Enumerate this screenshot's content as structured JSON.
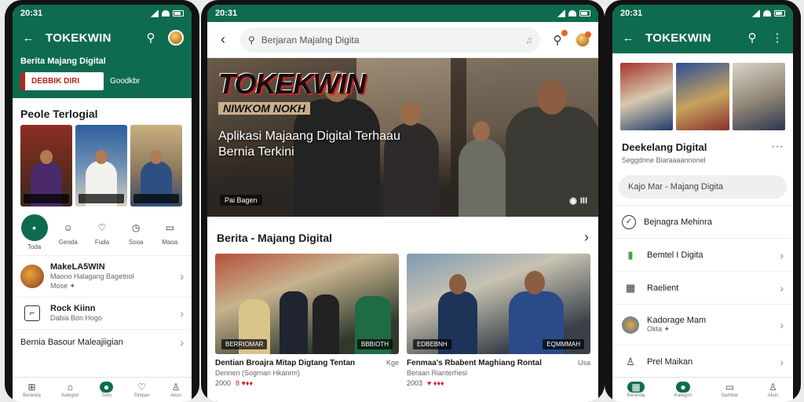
{
  "status_time": "20:31",
  "left": {
    "app_title": "TOKEKWIN",
    "banner_title": "Berita Majang Digital",
    "banner_card": "DEBBIK DIRI",
    "banner_side": "Goodkbr",
    "section_title": "Peole Terlogial",
    "tiles": [
      "",
      "",
      ""
    ],
    "quick": [
      {
        "label": "Toda",
        "icon": "•"
      },
      {
        "label": "Geoda",
        "icon": "☺"
      },
      {
        "label": "Fuda",
        "icon": "♡"
      },
      {
        "label": "Sooa",
        "icon": "◷"
      },
      {
        "label": "Maoa",
        "icon": "▭"
      }
    ],
    "list": [
      {
        "title": "MakeLA5WIN",
        "sub1": "Maono Halagang Bagetnol",
        "sub2": "Mose ✦"
      },
      {
        "title": "Rock Kiinn",
        "sub1": "Dabia Bon Hogo",
        "sub2": ""
      }
    ],
    "footer_item": "Bernia Basour Maleajiigian",
    "nav": [
      "Beranda",
      "Kategori",
      "Toko",
      "Simpan",
      "Akun"
    ]
  },
  "center": {
    "search_placeholder": "Berjaran Majalng Digita",
    "brand": "TOKEKWIN",
    "brand_sub": "NIWKOM NOKH",
    "hero_title": "Aplikasi Majaang Digital Terhaau Bernia Terkini",
    "hero_tag": "Pai Bagen",
    "hero_count": "III",
    "news_head": "Berita - Majang Digital",
    "news": [
      {
        "cap": "BERRIOMAR",
        "cnt": "BBBIOTH",
        "title": "Dentian Broajra Mitap Digtang Tentan",
        "time": "Kge",
        "sub": "Dennen (Sogrnan Hkanrm)",
        "meta1": "2000",
        "meta2": "8 ♥♦♦"
      },
      {
        "cap": "EDBEBNH",
        "cnt": "EQMMMAH",
        "title": "Fenmaa's Rbabent Maghiang Rontal",
        "time": "Usa",
        "sub": "Beraan Rianterhesi",
        "meta1": "2003",
        "meta2": "♥ ♦♦♦"
      }
    ]
  },
  "right": {
    "app_title": "TOKEKWIN",
    "title": "Deekelang Digital",
    "subtitle": "Seggdnne Biaraaaannonel",
    "search": "Kajo Mar - Majang Digita",
    "menu": [
      {
        "label": "Bejnagra Mehinra",
        "icon": "✓"
      },
      {
        "label": "Bemtel I Digita",
        "icon": "▮"
      },
      {
        "label": "Raelient",
        "icon": "▦"
      },
      {
        "label": "Kadorage Mam",
        "sub": "Okta ✦",
        "icon": "◉"
      },
      {
        "label": "Prel Maikan",
        "icon": "♙"
      }
    ],
    "nav": [
      "Beranda",
      "Kategori",
      "Gambar",
      "Akun"
    ]
  },
  "colors": {
    "primary": "#0e6b4f",
    "accent": "#c62828",
    "badge": "#e06a1f"
  }
}
